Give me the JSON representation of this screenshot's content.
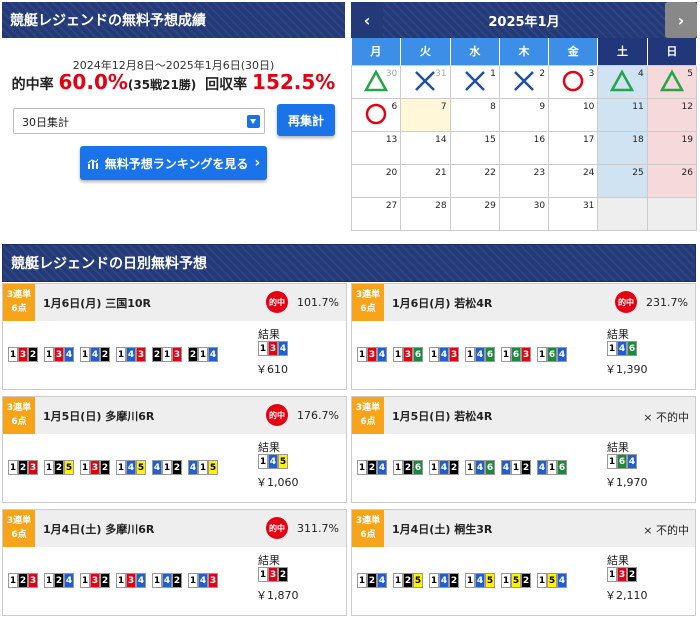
{
  "summary": {
    "title": "競艇レジェンドの無料予想成績",
    "period": "2024年12月8日～2025年1月6日(30日)",
    "hit_label": "的中率",
    "hit_rate": "60.0%",
    "record": "(35戦21勝)",
    "return_label": "回収率",
    "return_rate": "152.5%",
    "select_value": "30日集計",
    "recalc_label": "再集計",
    "ranking_label": "無料予想ランキングを見る"
  },
  "calendar": {
    "title": "2025年1月",
    "prev_glyph": "‹",
    "next_glyph": "›",
    "weekdays": [
      "月",
      "火",
      "水",
      "木",
      "金",
      "土",
      "日"
    ],
    "weeks": [
      [
        {
          "d": "30",
          "m": "tri",
          "prev": true
        },
        {
          "d": "31",
          "m": "x",
          "prev": true
        },
        {
          "d": "1",
          "m": "x"
        },
        {
          "d": "2",
          "m": "x"
        },
        {
          "d": "3",
          "m": "o"
        },
        {
          "d": "4",
          "m": "tri"
        },
        {
          "d": "5",
          "m": "tri"
        }
      ],
      [
        {
          "d": "6",
          "m": "o"
        },
        {
          "d": "7",
          "today": true
        },
        {
          "d": "8"
        },
        {
          "d": "9"
        },
        {
          "d": "10"
        },
        {
          "d": "11"
        },
        {
          "d": "12"
        }
      ],
      [
        {
          "d": "13"
        },
        {
          "d": "14"
        },
        {
          "d": "15"
        },
        {
          "d": "16"
        },
        {
          "d": "17"
        },
        {
          "d": "18"
        },
        {
          "d": "19"
        }
      ],
      [
        {
          "d": "20"
        },
        {
          "d": "21"
        },
        {
          "d": "22"
        },
        {
          "d": "23"
        },
        {
          "d": "24"
        },
        {
          "d": "25"
        },
        {
          "d": "26"
        }
      ],
      [
        {
          "d": "27"
        },
        {
          "d": "28"
        },
        {
          "d": "29"
        },
        {
          "d": "30"
        },
        {
          "d": "31"
        },
        {
          "empty": true
        },
        {
          "empty": true
        }
      ]
    ]
  },
  "daily": {
    "title": "競艇レジェンドの日別無料予想",
    "tag": "3連単\n6点",
    "result_label": "結果",
    "hit_text": "的中",
    "miss_text": "× 不的中",
    "cards": [
      {
        "race": "1月6日(月) 三国10R",
        "hit": true,
        "pct": "101.7%",
        "combos": [
          "132",
          "134",
          "142",
          "143",
          "213",
          "214"
        ],
        "result": "134",
        "payout": "￥610"
      },
      {
        "race": "1月6日(月) 若松4R",
        "hit": true,
        "pct": "231.7%",
        "combos": [
          "134",
          "136",
          "143",
          "146",
          "163",
          "164"
        ],
        "result": "146",
        "payout": "￥1,390"
      },
      {
        "race": "1月5日(日) 多摩川6R",
        "hit": true,
        "pct": "176.7%",
        "combos": [
          "123",
          "125",
          "132",
          "145",
          "412",
          "415"
        ],
        "result": "145",
        "payout": "￥1,060"
      },
      {
        "race": "1月5日(日) 若松4R",
        "hit": false,
        "pct": "",
        "combos": [
          "124",
          "126",
          "142",
          "146",
          "412",
          "416"
        ],
        "result": "164",
        "payout": "￥1,970"
      },
      {
        "race": "1月4日(土) 多摩川6R",
        "hit": true,
        "pct": "311.7%",
        "combos": [
          "123",
          "124",
          "132",
          "134",
          "142",
          "143"
        ],
        "result": "132",
        "payout": "￥1,870"
      },
      {
        "race": "1月4日(土) 桐生3R",
        "hit": false,
        "pct": "",
        "combos": [
          "124",
          "125",
          "142",
          "145",
          "152",
          "154"
        ],
        "result": "132",
        "payout": "￥2,110"
      }
    ]
  }
}
